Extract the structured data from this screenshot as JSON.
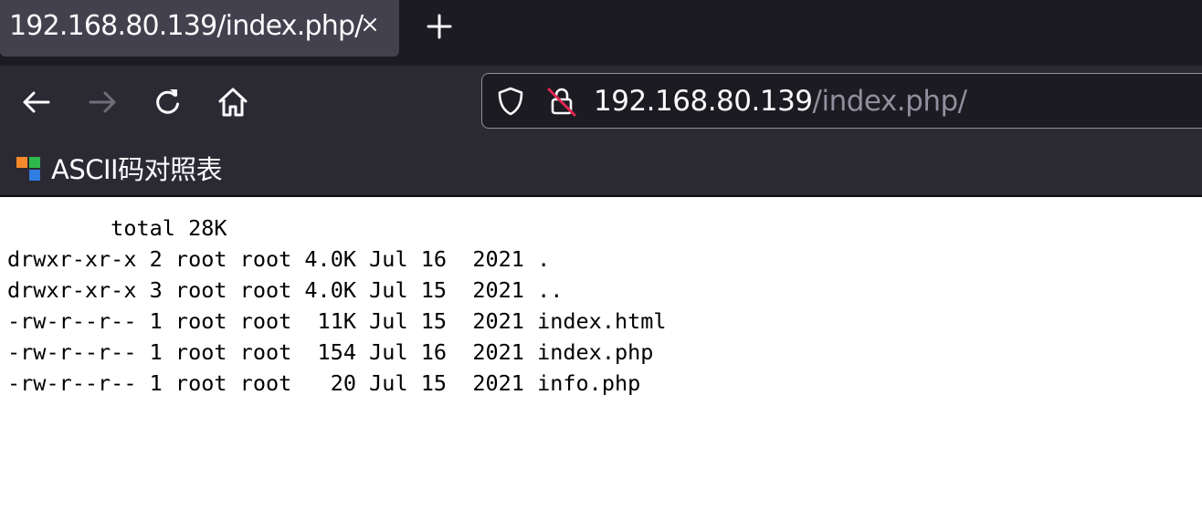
{
  "tab": {
    "title": "192.168.80.139/index.php/"
  },
  "urlbar": {
    "host": "192.168.80.139",
    "path": "/index.php/"
  },
  "bookmarks": [
    {
      "label": "ASCII码对照表"
    }
  ],
  "icons": {
    "tab_close": "close-icon",
    "new_tab": "plus-icon",
    "back": "arrow-left-icon",
    "forward": "arrow-right-icon",
    "reload": "reload-icon",
    "home": "home-icon",
    "tracking_protection": "shield-icon",
    "connection_insecure": "lock-insecure-icon",
    "bookmark_favicon": "colored-squares-icon"
  },
  "colors": {
    "tabstrip_bg": "#1c1b22",
    "toolbar_bg": "#2b2a33",
    "selected_tab_bg": "#42414d",
    "insecure_strike": "#e22850",
    "text_light": "#fbfbfe",
    "text_dim": "#8f8f9d"
  },
  "page": {
    "lines": [
      "        total 28K",
      "drwxr-xr-x 2 root root 4.0K Jul 16  2021 .",
      "drwxr-xr-x 3 root root 4.0K Jul 15  2021 ..",
      "-rw-r--r-- 1 root root  11K Jul 15  2021 index.html",
      "-rw-r--r-- 1 root root  154 Jul 16  2021 index.php",
      "-rw-r--r-- 1 root root   20 Jul 15  2021 info.php"
    ]
  }
}
